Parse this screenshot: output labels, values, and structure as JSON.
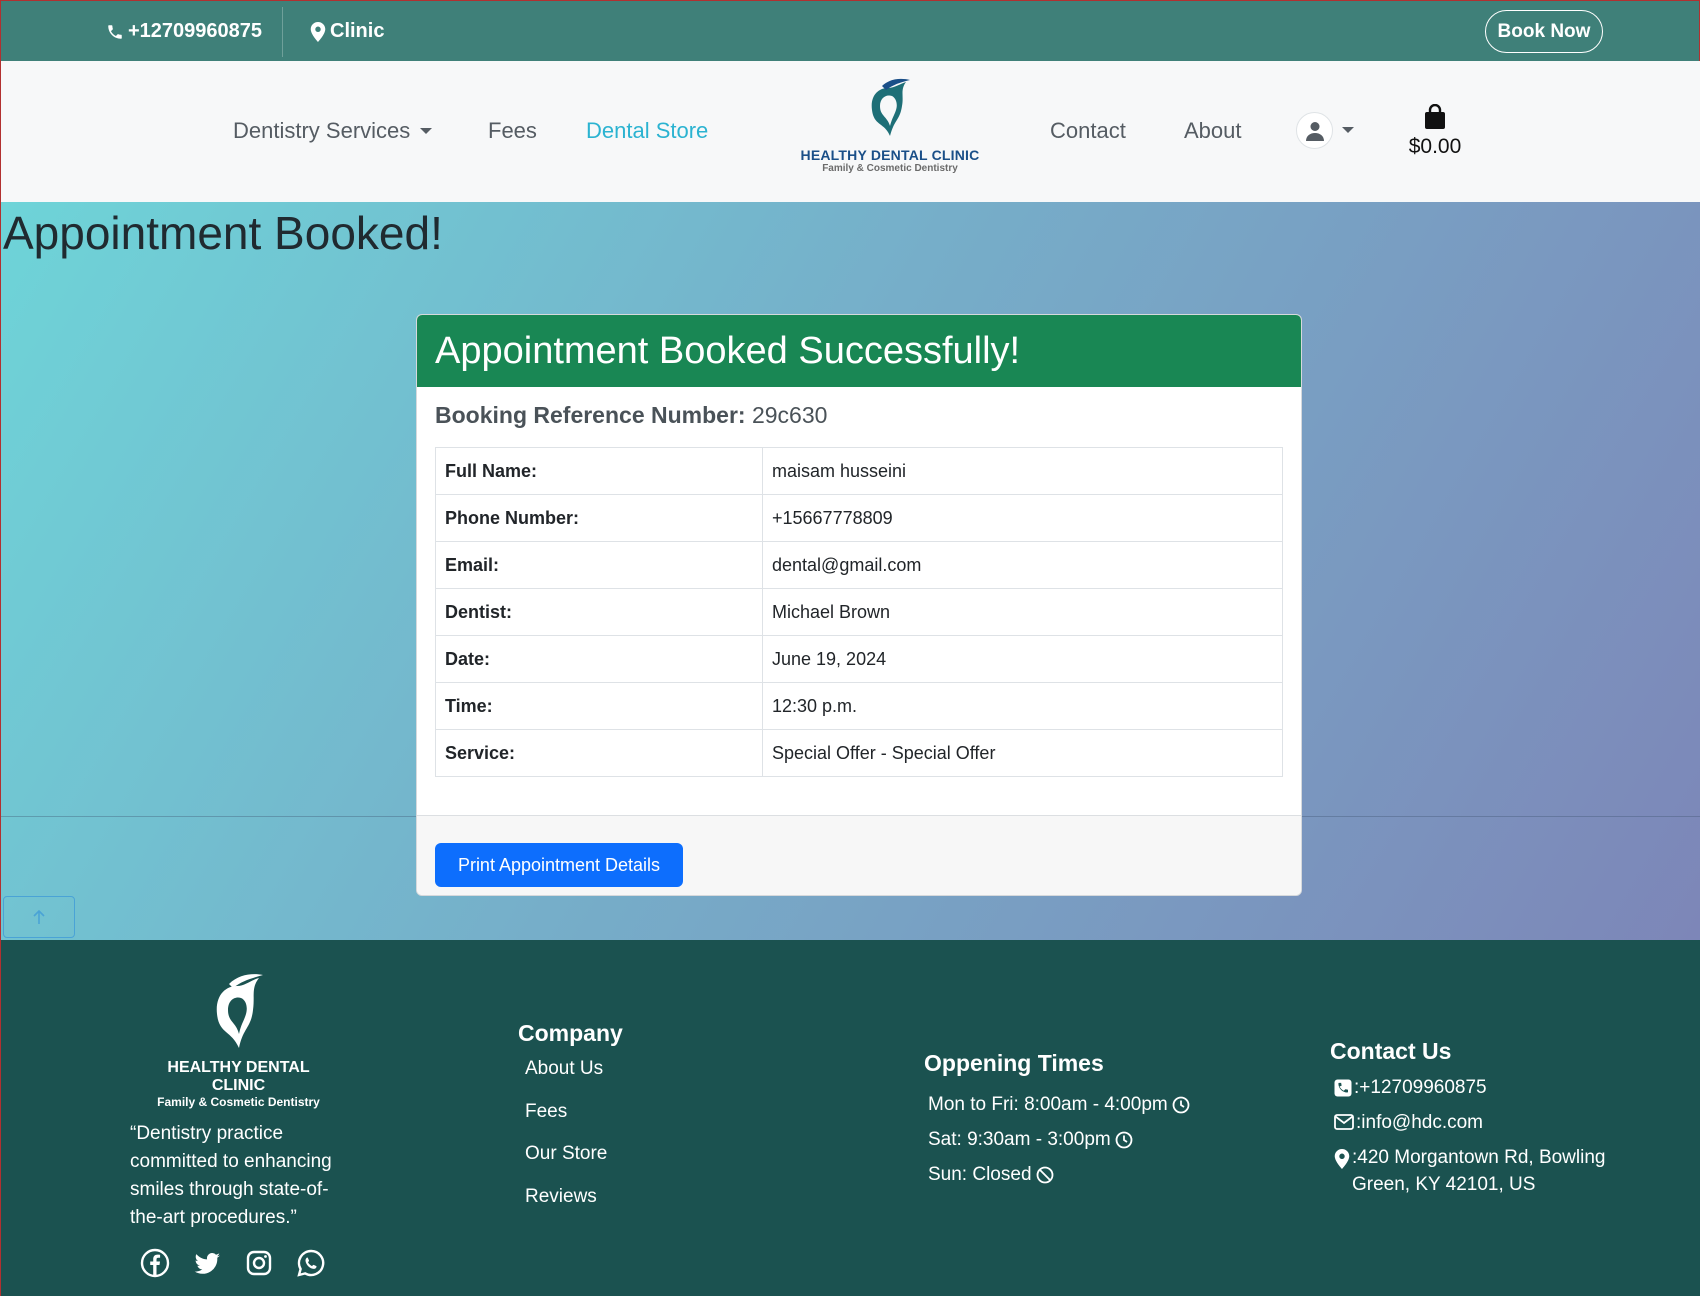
{
  "topbar": {
    "phone": "+12709960875",
    "clinic": "Clinic",
    "book_now": "Book Now"
  },
  "nav": {
    "services": "Dentistry Services",
    "fees": "Fees",
    "store": "Dental Store",
    "contact": "Contact",
    "about": "About",
    "logo_name": "HEALTHY DENTAL CLINIC",
    "logo_tagline": "Family & Cosmetic Dentistry",
    "cart_total": "$0.00"
  },
  "page": {
    "heading": "Appointment Booked!",
    "card_title": "Appointment Booked Successfully!",
    "ref_label": "Booking Reference Number:",
    "ref_value": "29c630",
    "print_button": "Print Appointment Details"
  },
  "details": [
    {
      "label": "Full Name:",
      "value": "maisam husseini"
    },
    {
      "label": "Phone Number:",
      "value": "+15667778809"
    },
    {
      "label": "Email:",
      "value": "dental@gmail.com"
    },
    {
      "label": "Dentist:",
      "value": "Michael Brown"
    },
    {
      "label": "Date:",
      "value": "June 19, 2024"
    },
    {
      "label": "Time:",
      "value": "12:30 p.m."
    },
    {
      "label": "Service:",
      "value": "Special Offer - Special Offer"
    }
  ],
  "footer": {
    "logo_name": "HEALTHY DENTAL CLINIC",
    "logo_tagline": "Family & Cosmetic Dentistry",
    "quote": "“Dentistry practice committed to enhancing smiles through state-of-the-art procedures.”",
    "company_title": "Company",
    "company_links": [
      "About Us",
      "Fees",
      "Our Store",
      "Reviews"
    ],
    "hours_title": "Oppening Times",
    "hours": [
      "Mon to Fri: 8:00am - 4:00pm",
      "Sat: 9:30am - 3:00pm",
      "Sun: Closed"
    ],
    "contact_title": "Contact Us",
    "contact_phone": ":+12709960875",
    "contact_email": ":info@hdc.com",
    "contact_address": ":420 Morgantown Rd, Bowling Green, KY 42101, US",
    "social_icons": [
      "facebook-icon",
      "twitter-icon",
      "instagram-icon",
      "whatsapp-icon"
    ]
  },
  "colors": {
    "topbar": "#3f8079",
    "accent": "#2bb3d1",
    "success": "#198754",
    "primary_button": "#0d6efd",
    "footer": "#1b5250"
  }
}
